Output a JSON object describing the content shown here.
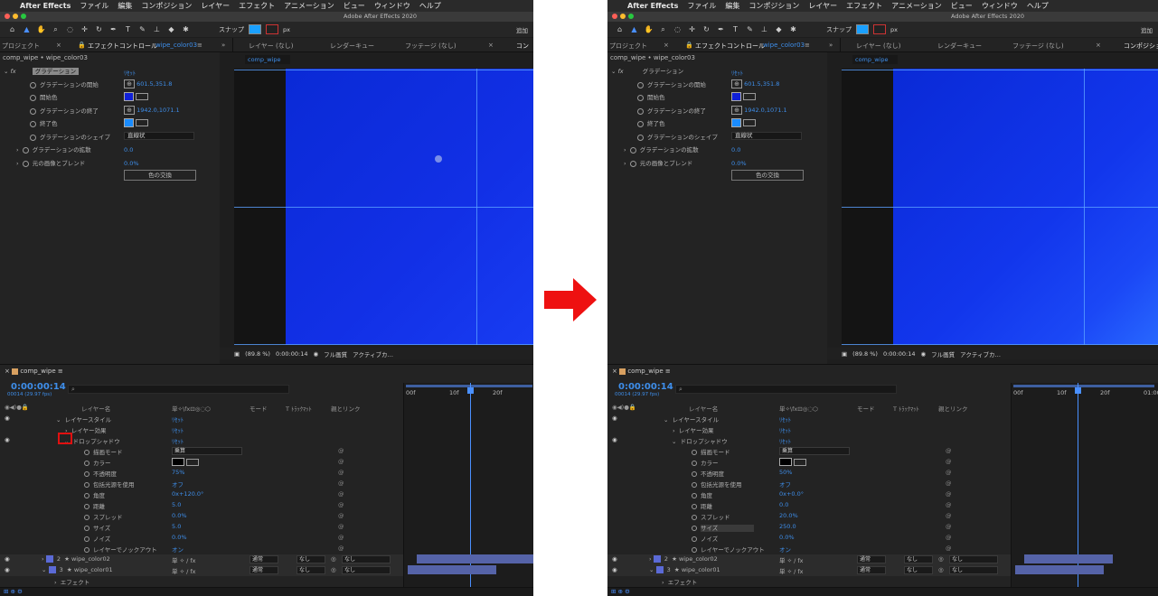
{
  "menubar": {
    "apple": "",
    "app": "After Effects",
    "items": [
      "ファイル",
      "編集",
      "コンポジション",
      "レイヤー",
      "エフェクト",
      "アニメーション",
      "ビュー",
      "ウィンドウ",
      "ヘルプ"
    ]
  },
  "window_title": "Adobe After Effects 2020",
  "toolbar": {
    "snap": "スナップ",
    "px": "px",
    "add": "追加"
  },
  "left": {
    "tabs": {
      "project": "プロジェクト",
      "effect_controls": "エフェクトコントロール",
      "effect_controls_sub": "wipe_color03",
      "layer": "レイヤー (なし)",
      "render": "レンダーキュー",
      "footage": "フッテージ (なし)",
      "comp": "コン"
    },
    "breadcrumb": "comp_wipe • wipe_color03",
    "effect_name": "グラデーション",
    "reset": "ﾘｾｯﾄ",
    "props": [
      {
        "label": "グラデーションの開始",
        "value": "601.5,351.8"
      },
      {
        "label": "開始色",
        "value": ""
      },
      {
        "label": "グラデーションの終了",
        "value": "1942.0,1071.1"
      },
      {
        "label": "終了色",
        "value": ""
      },
      {
        "label": "グラデーションのシェイプ",
        "value": "直線状"
      },
      {
        "label": "グラデーションの拡散",
        "value": "0.0"
      },
      {
        "label": "元の画像とブレンド",
        "value": "0.0%"
      }
    ],
    "swap_button": "色の交換",
    "viewer_tab": "comp_wipe",
    "viewer_footer": {
      "zoom": "(89.8 %)",
      "time": "0:00:00:14",
      "quality": "フル画質",
      "camera": "アクティブカ…"
    },
    "timeline": {
      "tab": "comp_wipe",
      "timecode": "0:00:00:14",
      "fps": "00014 (29.97 fps)",
      "search_placeholder": "",
      "columns": {
        "layer_name": "レイヤー名",
        "mode": "モード",
        "trkmat": "T  ﾄﾗｯｸﾏｯﾄ",
        "parent": "親とリンク"
      },
      "ruler": [
        "00f",
        "10f",
        "20f"
      ],
      "rows": [
        {
          "name": "レイヤースタイル",
          "value": "ﾘｾｯﾄ"
        },
        {
          "name": "レイヤー効果",
          "value": "ﾘｾｯﾄ"
        },
        {
          "name": "ドロップシャドウ",
          "value": "ﾘｾｯﾄ"
        },
        {
          "name": "描画モード",
          "value": "乗算"
        },
        {
          "name": "カラー",
          "value": ""
        },
        {
          "name": "不透明度",
          "value": "75%"
        },
        {
          "name": "包括光源を使用",
          "value": "オフ"
        },
        {
          "name": "角度",
          "value": "0x+120.0°"
        },
        {
          "name": "距離",
          "value": "5.0"
        },
        {
          "name": "スプレッド",
          "value": "0.0%"
        },
        {
          "name": "サイズ",
          "value": "5.0"
        },
        {
          "name": "ノイズ",
          "value": "0.0%"
        },
        {
          "name": "レイヤーでノックアウト",
          "value": "オン"
        }
      ],
      "layers": [
        {
          "num": "2",
          "name": "wipe_color02",
          "mode": "通常",
          "trk": "なし",
          "parent": "なし"
        },
        {
          "num": "3",
          "name": "wipe_color01",
          "mode": "通常",
          "trk": "なし",
          "parent": "なし"
        }
      ],
      "effects_row": "エフェクト"
    }
  },
  "right": {
    "tabs": {
      "project": "プロジェクト",
      "effect_controls": "エフェクトコントロール",
      "effect_controls_sub": "wipe_color03",
      "layer": "レイヤー (なし)",
      "render": "レンダーキュー",
      "footage": "フッテージ (なし)",
      "comp": "コンポジショ"
    },
    "breadcrumb": "comp_wipe • wipe_color03",
    "effect_name": "グラデーション",
    "reset": "ﾘｾｯﾄ",
    "props": [
      {
        "label": "グラデーションの開始",
        "value": "601.5,351.8"
      },
      {
        "label": "開始色",
        "value": ""
      },
      {
        "label": "グラデーションの終了",
        "value": "1942.0,1071.1"
      },
      {
        "label": "終了色",
        "value": ""
      },
      {
        "label": "グラデーションのシェイプ",
        "value": "直線状"
      },
      {
        "label": "グラデーションの拡散",
        "value": "0.0"
      },
      {
        "label": "元の画像とブレンド",
        "value": "0.0%"
      }
    ],
    "swap_button": "色の交換",
    "viewer_tab": "comp_wipe",
    "viewer_footer": {
      "zoom": "(89.8 %)",
      "time": "0:00:00:14",
      "quality": "フル画質",
      "camera": "アクティブカ…"
    },
    "timeline": {
      "tab": "comp_wipe",
      "timecode": "0:00:00:14",
      "fps": "00014 (29.97 fps)",
      "search_placeholder": "",
      "columns": {
        "layer_name": "レイヤー名",
        "mode": "モード",
        "trkmat": "T  ﾄﾗｯｸﾏｯﾄ",
        "parent": "親とリンク"
      },
      "ruler": [
        "00f",
        "10f",
        "20f",
        "01:00f"
      ],
      "rows": [
        {
          "name": "レイヤースタイル",
          "value": "ﾘｾｯﾄ"
        },
        {
          "name": "レイヤー効果",
          "value": "ﾘｾｯﾄ"
        },
        {
          "name": "ドロップシャドウ",
          "value": "ﾘｾｯﾄ"
        },
        {
          "name": "描画モード",
          "value": "乗算"
        },
        {
          "name": "カラー",
          "value": ""
        },
        {
          "name": "不透明度",
          "value": "50%"
        },
        {
          "name": "包括光源を使用",
          "value": "オフ"
        },
        {
          "name": "角度",
          "value": "0x+0.0°"
        },
        {
          "name": "距離",
          "value": "0.0"
        },
        {
          "name": "スプレッド",
          "value": "20.0%"
        },
        {
          "name": "サイズ",
          "value": "250.0"
        },
        {
          "name": "ノイズ",
          "value": "0.0%"
        },
        {
          "name": "レイヤーでノックアウト",
          "value": "オン"
        }
      ],
      "layers": [
        {
          "num": "2",
          "name": "wipe_color02",
          "mode": "通常",
          "trk": "なし",
          "parent": "なし"
        },
        {
          "num": "3",
          "name": "wipe_color01",
          "mode": "通常",
          "trk": "なし",
          "parent": "なし"
        }
      ],
      "effects_row": "エフェクト"
    }
  },
  "colors": {
    "accent": "#3e8eea",
    "arrow": "#ee1111",
    "comp_blue": "#1a3ff0"
  }
}
